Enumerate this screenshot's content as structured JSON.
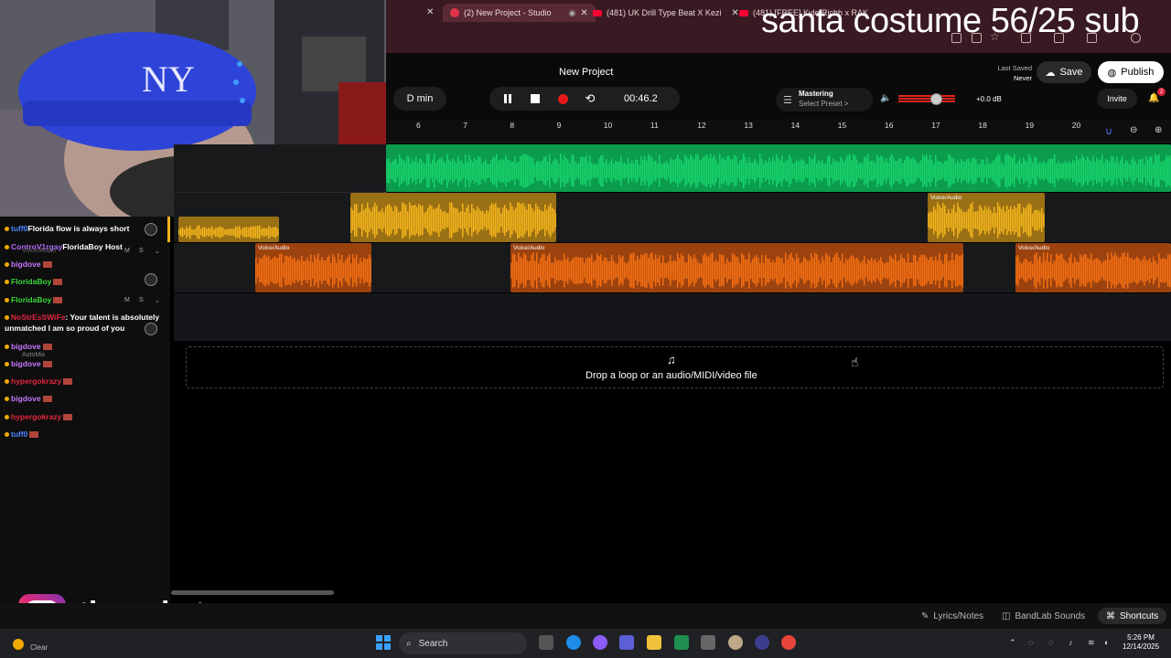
{
  "browser": {
    "tabs": [
      {
        "label": "(2) New Project - Studio"
      },
      {
        "label": "(481) UK Drill Type Beat X Kezi"
      },
      {
        "label": "(481) [FREE] Kyle Richh x RAK"
      }
    ]
  },
  "stream_overlay": {
    "banner_text": "santa costume 56/25 sub",
    "instagram_handle": "thenokster"
  },
  "studio": {
    "project_title": "New Project",
    "key": "D min",
    "time": "00:46.2",
    "mastering": {
      "label": "Mastering",
      "preset": "Select Preset >"
    },
    "volume_db": "+0.0 dB",
    "last_saved_label": "Last Saved",
    "last_saved_value": "Never",
    "save_label": "Save",
    "publish_label": "Publish",
    "invite_label": "Invite",
    "notification_count": "2",
    "ruler": [
      "6",
      "7",
      "8",
      "9",
      "10",
      "11",
      "12",
      "13",
      "14",
      "15",
      "16",
      "17",
      "18",
      "19",
      "20"
    ],
    "clip_label": "Voice/Audio",
    "drop_text": "Drop a loop or an audio/MIDI/video file",
    "bottom": {
      "lyrics": "Lyrics/Notes",
      "sounds": "BandLab Sounds",
      "shortcuts": "Shortcuts"
    },
    "colors": {
      "green": "#17d36b",
      "yellow": "#f3b41b",
      "orange": "#f46f12"
    }
  },
  "chat": {
    "messages": [
      {
        "user": "tuff0",
        "text": "Florida flow is always short",
        "color": "#4d86ff"
      },
      {
        "user": "ControV1rgay",
        "text": "FloridaBoy Host",
        "color": "#b36bff"
      },
      {
        "user": "bigdove",
        "text": "",
        "color": "#c775ff"
      },
      {
        "user": "FloridaBoy",
        "text": "",
        "color": "#3ad63a"
      },
      {
        "user": "FloridaBoy",
        "text": "",
        "color": "#3ad63a"
      },
      {
        "user": "NoStrEsSWiFe",
        "text": ": Your talent is absolutely",
        "color": "#e0263d"
      },
      {
        "user": "",
        "text": "unmatched I am so proud of you",
        "color": "#fff"
      },
      {
        "user": "bigdove",
        "text": "",
        "color": "#c775ff"
      },
      {
        "user": "bigdove",
        "text": "",
        "color": "#c775ff"
      },
      {
        "user": "hypergokrazy",
        "text": "",
        "color": "#e0263d"
      },
      {
        "user": "bigdove",
        "text": "",
        "color": "#c775ff"
      },
      {
        "user": "hypergokrazy",
        "text": "",
        "color": "#e0263d"
      },
      {
        "user": "tuff0",
        "text": "",
        "color": "#4d86ff"
      }
    ],
    "track_names": {
      "track1": "Voice/Audio",
      "automix": "AutoMix"
    },
    "ms": {
      "m": "M",
      "s": "S"
    }
  },
  "taskbar": {
    "search": "Search",
    "time": "5:26 PM",
    "date": "12/14/2025",
    "weather": "Clear"
  }
}
